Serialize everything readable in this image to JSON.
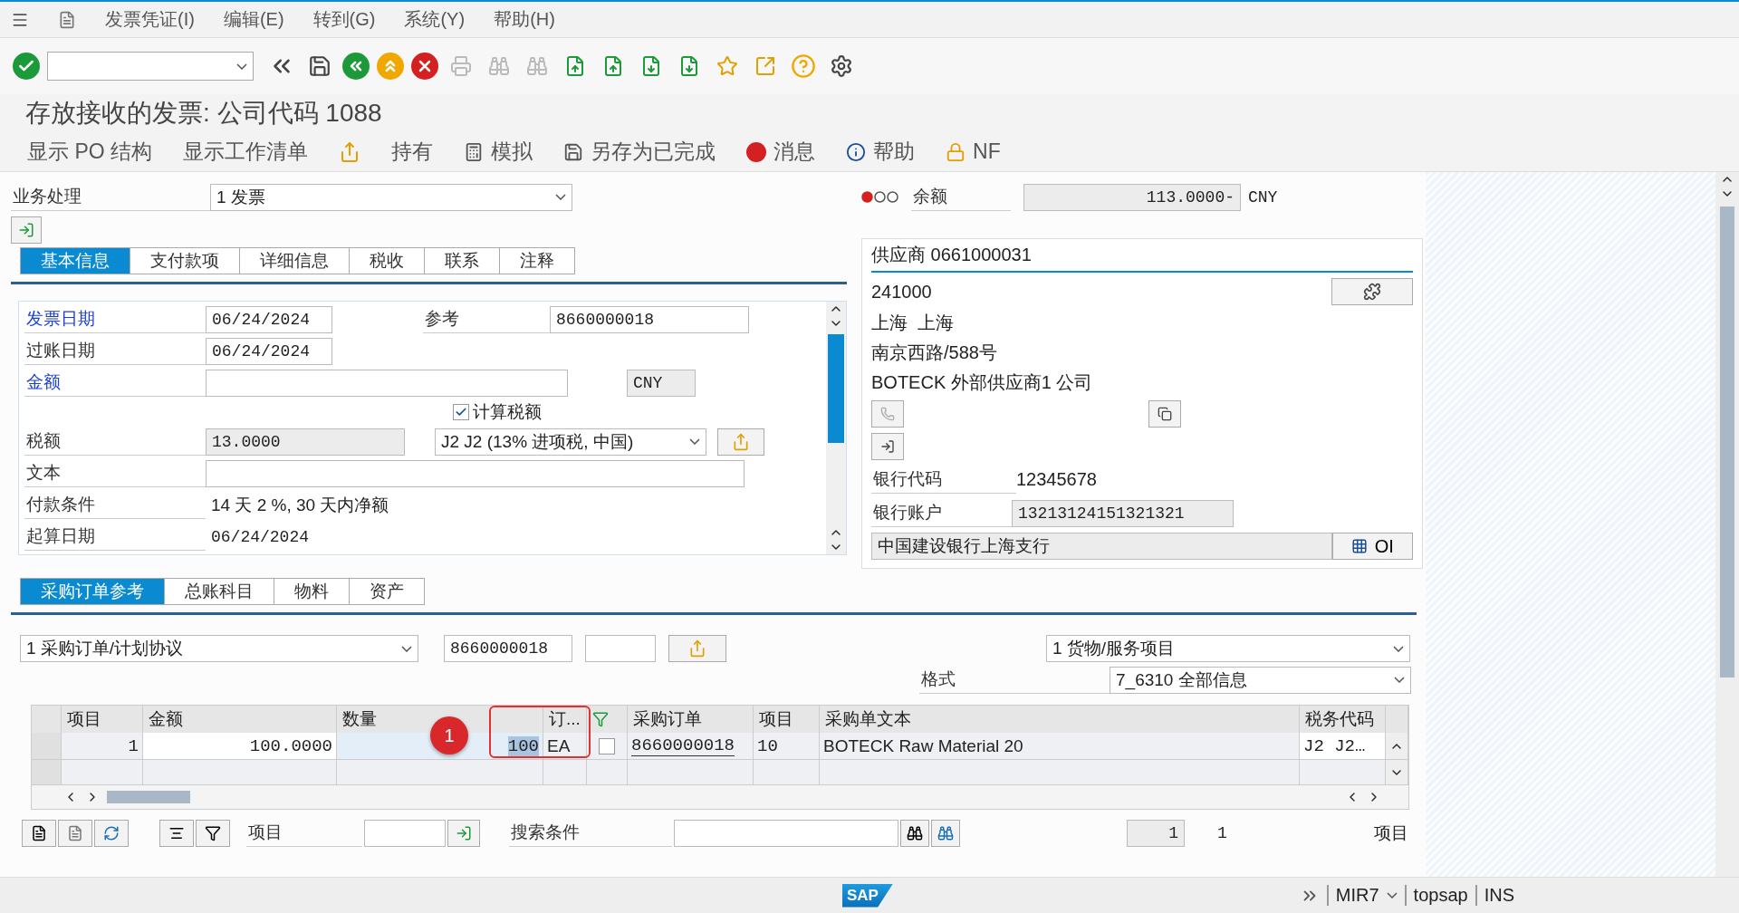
{
  "menu": [
    {
      "label": "发票凭证(I)"
    },
    {
      "label": "编辑(E)"
    },
    {
      "label": "转到(G)"
    },
    {
      "label": "系统(Y)"
    },
    {
      "label": "帮助(H)"
    }
  ],
  "title": "存放接收的发票: 公司代码 1088",
  "app_toolbar": [
    {
      "kind": "text",
      "label": "显示 PO 结构"
    },
    {
      "kind": "text",
      "label": "显示工作清单"
    },
    {
      "kind": "transfer"
    },
    {
      "kind": "text",
      "label": "持有"
    },
    {
      "kind": "abacus",
      "label": "模拟"
    },
    {
      "kind": "save",
      "label": "另存为已完成"
    },
    {
      "kind": "message",
      "label": "消息"
    },
    {
      "kind": "info",
      "label": "帮助"
    },
    {
      "kind": "nf",
      "label": "NF"
    }
  ],
  "transaction": {
    "label": "业务处理",
    "value": "1 发票"
  },
  "balance": {
    "lights": [
      {
        "on": true
      },
      {
        "on": false
      },
      {
        "on": false
      }
    ],
    "label": "余额",
    "value": "113.0000-",
    "currency": "CNY"
  },
  "header_tabs": [
    {
      "label": "基本信息",
      "selected": true
    },
    {
      "label": "支付款项",
      "selected": false
    },
    {
      "label": "详细信息",
      "selected": false
    },
    {
      "label": "税收",
      "selected": false
    },
    {
      "label": "联系",
      "selected": false
    },
    {
      "label": "注释",
      "selected": false
    }
  ],
  "basic": {
    "invoice_date": {
      "label": "发票日期",
      "link": true,
      "value": "06/24/2024"
    },
    "reference": {
      "label": "参考",
      "value": "8660000018"
    },
    "posting_date": {
      "label": "过账日期",
      "link": false,
      "value": "06/24/2024"
    },
    "amount": {
      "label": "金额",
      "link": true,
      "currency": "CNY"
    },
    "calc_tax": {
      "label": "计算税额",
      "checked": true
    },
    "tax_amount": {
      "label": "税额",
      "value": "13.0000"
    },
    "tax_code": {
      "value": "J2 J2 (13% 进项税, 中国)"
    },
    "text": {
      "label": "文本"
    },
    "payment_terms": {
      "label": "付款条件",
      "value": "14 天 2 %, 30 天内净额"
    },
    "baseline_date": {
      "label": "起算日期",
      "value": "06/24/2024"
    }
  },
  "vendor": {
    "title": "供应商 0661000031",
    "address_lines": [
      "241000",
      "上海  上海",
      "南京西路/588号",
      "BOTECK 外部供应商1 公司"
    ],
    "bank_key": {
      "label": "银行代码",
      "value": "12345678"
    },
    "bank_account": {
      "label": "银行账户",
      "value": "13213124151321321"
    },
    "bank_name": "中国建设银行上海支行",
    "oi_button": "OI"
  },
  "item_tabs": [
    {
      "label": "采购订单参考",
      "selected": true
    },
    {
      "label": "总账科目",
      "selected": false
    },
    {
      "label": "物料",
      "selected": false
    },
    {
      "label": "资产",
      "selected": false
    }
  ],
  "po_reference": {
    "doc_type": "1 采购订单/计划协议",
    "po_number": "8660000018",
    "layout_type": "1 货物/服务项目",
    "format_label": "格式",
    "format": "7_6310 全部信息"
  },
  "table": {
    "columns": [
      {
        "kind": "text",
        "label": "项目"
      },
      {
        "kind": "text",
        "label": "金额"
      },
      {
        "kind": "text",
        "label": "数量"
      },
      {
        "kind": "text",
        "label": "订..."
      },
      {
        "kind": "icon"
      },
      {
        "kind": "text",
        "label": "采购订单"
      },
      {
        "kind": "text",
        "label": "项目"
      },
      {
        "kind": "text",
        "label": "采购单文本"
      },
      {
        "kind": "text",
        "label": "税务代码"
      }
    ],
    "rows": [
      {
        "item": "1",
        "amount": "100.0000",
        "quantity": "100",
        "quantity_focused": true,
        "unit": "EA",
        "checked": false,
        "po": "8660000018",
        "po_item": "10",
        "text": "BOTECK Raw Material 20",
        "tax_code": "J2  J2…"
      }
    ]
  },
  "annotation": {
    "label": "1"
  },
  "bottom_bar": {
    "item_label": "项目",
    "search_label": "搜索条件",
    "page": "1",
    "total": "1",
    "items_label": "项目"
  },
  "status_bar": {
    "logo": "SAP",
    "transaction": "MIR7",
    "user": "topsap",
    "mode": "INS"
  }
}
